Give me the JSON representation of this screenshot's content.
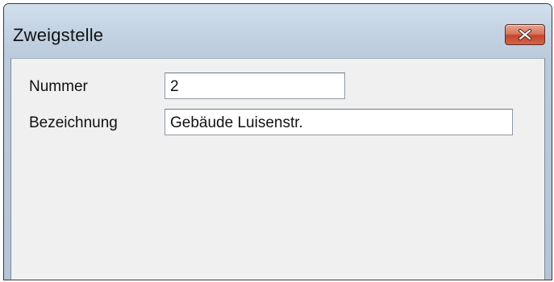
{
  "window": {
    "title": "Zweigstelle"
  },
  "form": {
    "nummer": {
      "label": "Nummer",
      "value": "2"
    },
    "bezeichnung": {
      "label": "Bezeichnung",
      "value": "Gebäude Luisenstr."
    }
  },
  "icons": {
    "close": "close-icon"
  },
  "colors": {
    "close_button": "#c3452b",
    "client_background": "#f0f0f0",
    "titlebar": "#c5d4e4"
  }
}
